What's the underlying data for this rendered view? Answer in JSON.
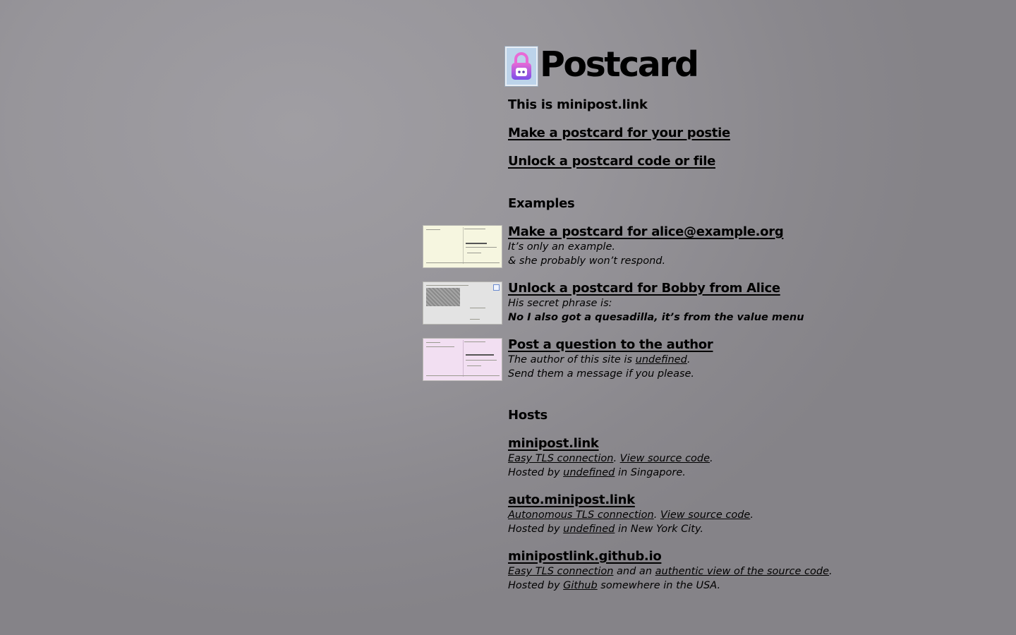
{
  "header": {
    "logo_icon": "padlock-stamp-icon",
    "title": "Postcard"
  },
  "intro": "This is minipost.link",
  "links": {
    "make": "Make a postcard for your postie",
    "unlock": "Unlock a postcard code or file"
  },
  "examples": {
    "heading": "Examples",
    "items": [
      {
        "title": "Make a postcard for alice@example.org",
        "line1": "It’s only an example.",
        "line2": "& she probably won’t respond.",
        "thumb_color": "#f6f6e0"
      },
      {
        "title": "Unlock a postcard for Bobby from Alice",
        "line1": "His secret phrase is:",
        "line2": "No I also got a quesadilla, it’s from the value menu",
        "thumb_color": "#e3e3e3"
      },
      {
        "title": "Post a question to the author",
        "line1_pre": "The author of this site is ",
        "line1_link": "undefined",
        "line1_post": ".",
        "line2": "Send them a message if you please.",
        "thumb_color": "#f2dff2"
      }
    ]
  },
  "hosts": {
    "heading": "Hosts",
    "items": [
      {
        "name": "minipost.link",
        "link1": "Easy TLS connection",
        "sep": ". ",
        "link2": "View source code",
        "end": ".",
        "hosted_pre": "Hosted by ",
        "host": "undefined",
        "hosted_post": " in Singapore."
      },
      {
        "name": "auto.minipost.link",
        "link1": "Autonomous TLS connection",
        "sep": ". ",
        "link2": "View source code",
        "end": ".",
        "hosted_pre": "Hosted by ",
        "host": "undefined",
        "hosted_post": " in New York City."
      },
      {
        "name": "minipostlink.github.io",
        "link1": "Easy TLS connection",
        "sep": " and an ",
        "link2": "authentic view of the source code",
        "end": ".",
        "hosted_pre": "Hosted by ",
        "host": "Github",
        "hosted_post": " somewhere in the USA."
      }
    ]
  },
  "colors": {
    "background": "#9a989d",
    "stamp_blue": "#bcd3ea",
    "lock_pink": "#e86ad6",
    "lock_purple": "#7b4ee8"
  }
}
